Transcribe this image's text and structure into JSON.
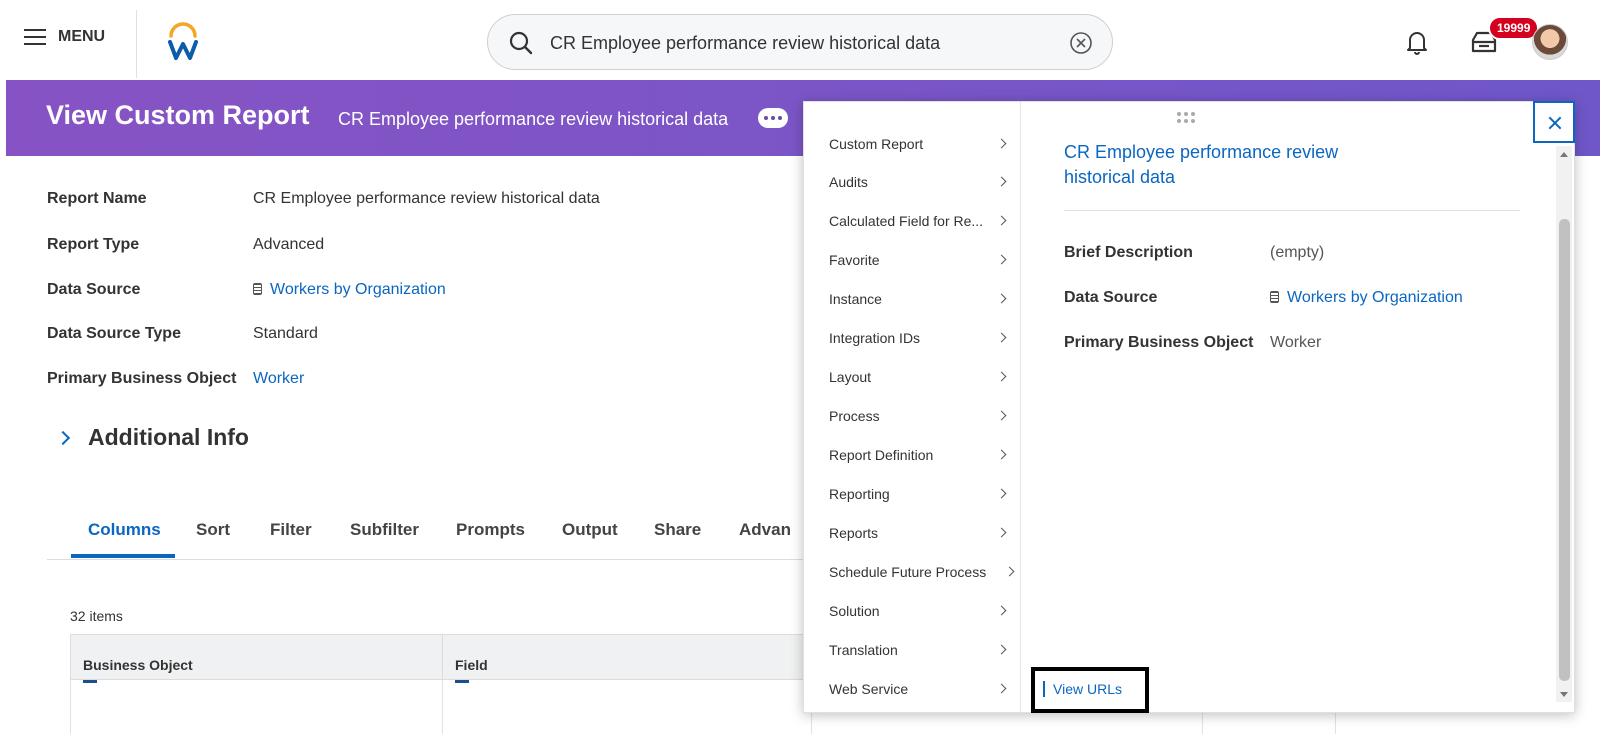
{
  "topbar": {
    "menu_label": "MENU",
    "search_value": "CR Employee performance review historical data",
    "notification_count": "19999"
  },
  "header": {
    "title": "View Custom Report",
    "subtitle": "CR Employee performance review historical data"
  },
  "details": [
    {
      "label": "Report Name",
      "value": "CR Employee performance review historical data",
      "link": false
    },
    {
      "label": "Report Type",
      "value": "Advanced",
      "link": false
    },
    {
      "label": "Data Source",
      "value": "Workers by Organization",
      "link": true
    },
    {
      "label": "Data Source Type",
      "value": "Standard",
      "link": false
    },
    {
      "label": "Primary Business Object",
      "value": "Worker",
      "link": true
    }
  ],
  "additional_info": "Additional Info",
  "tabs": [
    "Columns",
    "Sort",
    "Filter",
    "Subfilter",
    "Prompts",
    "Output",
    "Share",
    "Advan"
  ],
  "items_count": "32 items",
  "table": {
    "headers": [
      "Business Object",
      "Field"
    ]
  },
  "popup": {
    "menu_items": [
      "Custom Report",
      "Audits",
      "Calculated Field for Re...",
      "Favorite",
      "Instance",
      "Integration IDs",
      "Layout",
      "Process",
      "Report Definition",
      "Reporting",
      "Reports",
      "Schedule Future Process",
      "Solution",
      "Translation",
      "Web Service"
    ],
    "pane_title": "CR Employee performance review historical data",
    "pane_rows": [
      {
        "label": "Brief Description",
        "value": "(empty)"
      },
      {
        "label": "Data Source",
        "value": "Workers by Organization"
      },
      {
        "label": "Primary Business Object",
        "value": "Worker"
      }
    ],
    "submenu_link": "View URLs"
  },
  "colors": {
    "header_start": "#8753c4",
    "header_end": "#6f57c9",
    "link": "#0b66c2",
    "badge": "#d5001f"
  }
}
